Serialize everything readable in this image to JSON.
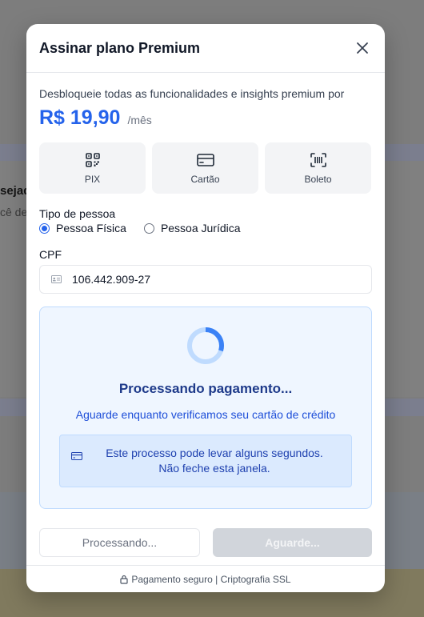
{
  "background": {
    "partial_heading": "sejad",
    "partial_text": "cê de"
  },
  "modal": {
    "title": "Assinar plano Premium",
    "unlock_text": "Desbloqueie todas as funcionalidades e insights premium por",
    "price": "R$ 19,90",
    "price_period": "/mês",
    "payment_methods": [
      {
        "label": "PIX",
        "icon": "qr-code-icon"
      },
      {
        "label": "Cartão",
        "icon": "credit-card-icon"
      },
      {
        "label": "Boleto",
        "icon": "barcode-icon"
      }
    ],
    "person_type_label": "Tipo de pessoa",
    "person_types": [
      {
        "label": "Pessoa Física",
        "checked": true
      },
      {
        "label": "Pessoa Jurídica",
        "checked": false
      }
    ],
    "cpf_label": "CPF",
    "cpf_value": "106.442.909-27",
    "processing": {
      "progress": 0.3,
      "title": "Processando pagamento...",
      "subtitle": "Aguarde enquanto verificamos seu cartão de crédito",
      "notice_line1": "Este processo pode levar alguns segundos.",
      "notice_line2": "Não feche esta janela."
    },
    "secondary_button": "Processando...",
    "primary_button": "Aguarde...",
    "footer": "Pagamento seguro | Criptografia SSL"
  },
  "colors": {
    "accent": "#2563eb",
    "processing_bg": "#eff6ff",
    "notice_bg": "#dbeafe",
    "disabled_button": "#d1d5db"
  }
}
